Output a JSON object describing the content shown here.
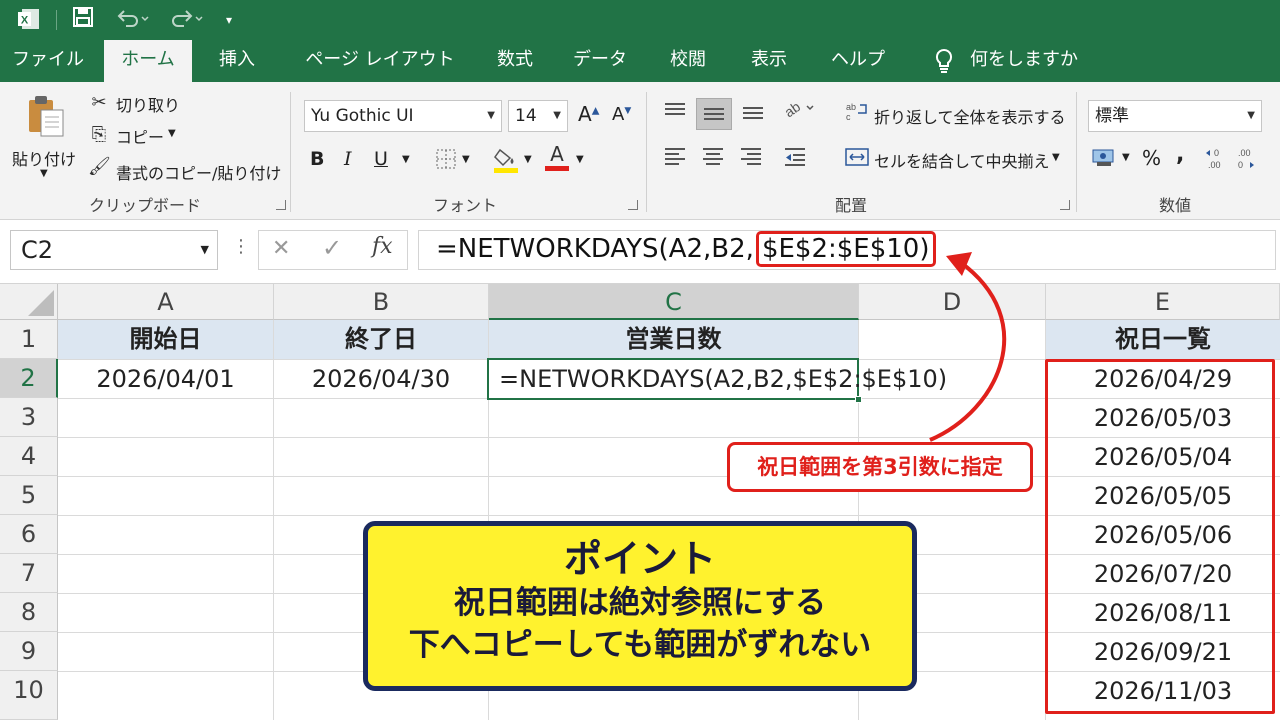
{
  "qat": {
    "app_icon": "excel-icon",
    "save": "save-icon",
    "undo": "undo-icon",
    "redo": "redo-icon",
    "customize": "▾"
  },
  "tabs": [
    "ファイル",
    "ホーム",
    "挿入",
    "ページ レイアウト",
    "数式",
    "データ",
    "校閲",
    "表示",
    "ヘルプ"
  ],
  "tell_me": "何をしますか",
  "ribbon": {
    "clipboard": {
      "paste": "貼り付け",
      "cut": "切り取り",
      "copy": "コピー",
      "format_painter": "書式のコピー/貼り付け",
      "label": "クリップボード"
    },
    "font": {
      "name": "Yu Gothic UI",
      "size": "14",
      "bold": "B",
      "italic": "I",
      "underline": "U",
      "grow": "A",
      "shrink": "A",
      "font_color": "A",
      "label": "フォント"
    },
    "alignment": {
      "wrap": "折り返して全体を表示する",
      "merge": "セルを結合して中央揃え",
      "label": "配置"
    },
    "number": {
      "format": "標準",
      "percent": "%",
      "comma": ",",
      "inc_dec": "←0\n.00",
      "dec_dec": ".00\n→0",
      "label": "数値"
    }
  },
  "formula_bar": {
    "name_box": "C2",
    "cancel": "✕",
    "enter": "✓",
    "fx": "fx",
    "formula_prefix": "=NETWORKDAYS(A2,B2,",
    "formula_highlight": "$E$2:$E$10)"
  },
  "columns": [
    "A",
    "B",
    "C",
    "D",
    "E"
  ],
  "rows": [
    "1",
    "2",
    "3",
    "4",
    "5",
    "6",
    "7",
    "8",
    "9",
    "10"
  ],
  "sheet": {
    "headers": {
      "a1": "開始日",
      "b1": "終了日",
      "c1": "営業日数",
      "e1": "祝日一覧"
    },
    "a2": "2026/04/01",
    "b2": "2026/04/30",
    "c2": "=NETWORKDAYS(A2,B2,$E$2:$E$10)",
    "holidays": [
      "2026/04/29",
      "2026/05/03",
      "2026/05/04",
      "2026/05/05",
      "2026/05/06",
      "2026/07/20",
      "2026/08/11",
      "2026/09/21",
      "2026/11/03"
    ]
  },
  "callout": "祝日範囲を第3引数に指定",
  "point_box": {
    "title": "ポイント",
    "line1": "祝日範囲は絶対参照にする",
    "line2": "下へコピーしても範囲がずれない"
  },
  "colors": {
    "excel_green": "#217346",
    "header_fill": "#dce6f1",
    "accent_red": "#e0201b",
    "point_yellow": "#fff22e",
    "point_border": "#1a2a5e"
  }
}
